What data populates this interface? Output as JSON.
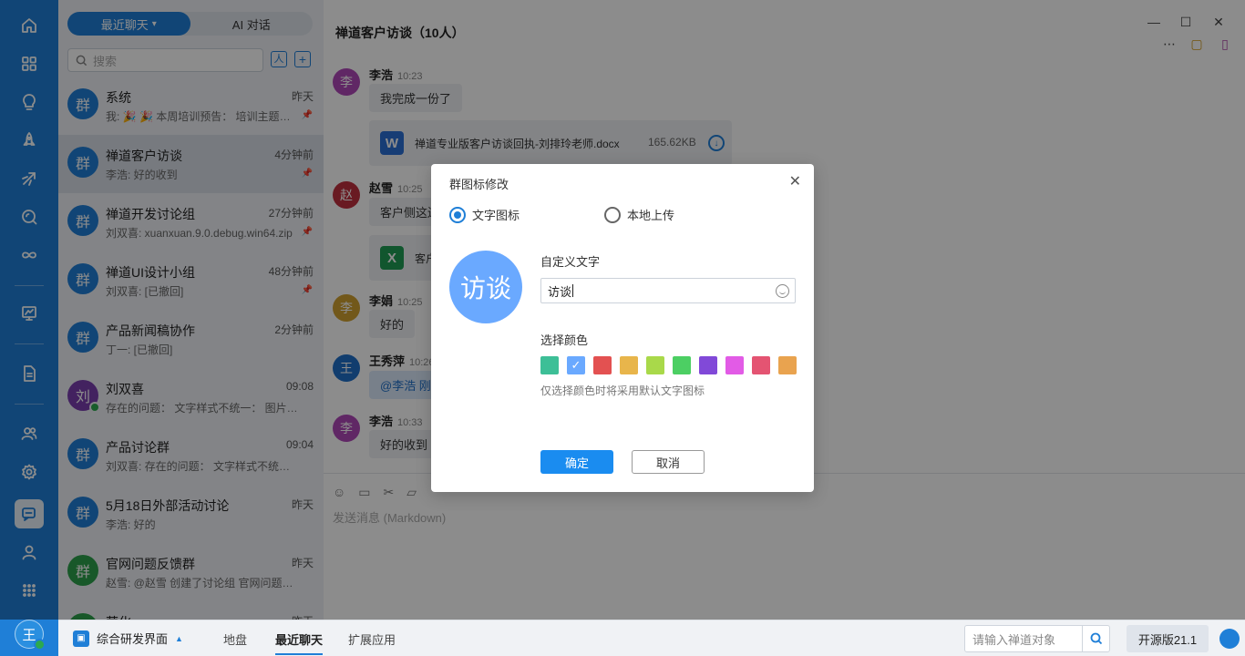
{
  "sidebar": {
    "icons": [
      "home-icon",
      "apps-icon",
      "lightbulb-icon",
      "rocket-icon",
      "sprint-icon",
      "search-icon",
      "infinity-icon",
      "screen-chart-icon",
      "document-icon",
      "team-icon",
      "settings-icon",
      "chat-icon",
      "user-icon",
      "grid-icon"
    ],
    "avatar_letter": "王"
  },
  "list": {
    "tabs": [
      "最近聊天",
      "AI 对话"
    ],
    "search_placeholder": "搜索",
    "conversations": [
      {
        "avatar": "群",
        "name": "系统",
        "time": "昨天",
        "preview": "我: 🎉 🎉 本周培训预告：  培训主题：...",
        "pinned": true
      },
      {
        "avatar": "群",
        "name": "禅道客户访谈",
        "time": "4分钟前",
        "preview": "李浩: 好的收到",
        "pinned": true
      },
      {
        "avatar": "群",
        "name": "禅道开发讨论组",
        "time": "27分钟前",
        "preview": "刘双喜: xuanxuan.9.0.debug.win64.zip",
        "pinned": true
      },
      {
        "avatar": "群",
        "name": "禅道UI设计小组",
        "time": "48分钟前",
        "preview": "刘双喜: [已撤回]",
        "pinned": true
      },
      {
        "avatar": "群",
        "name": "产品新闻稿协作",
        "time": "2分钟前",
        "preview": "丁一: [已撤回]",
        "pinned": false
      },
      {
        "avatar": "刘",
        "name": "刘双喜",
        "time": "09:08",
        "preview": "存在的问题：  文字样式不统一：  图片大...",
        "pinned": false
      },
      {
        "avatar": "群",
        "name": "产品讨论群",
        "time": "09:04",
        "preview": "刘双喜: 存在的问题：  文字样式不统一：...",
        "pinned": false
      },
      {
        "avatar": "群",
        "name": "5月18日外部活动讨论",
        "time": "昨天",
        "preview": "李浩: 好的",
        "pinned": false
      },
      {
        "avatar": "群",
        "name": "官网问题反馈群",
        "time": "昨天",
        "preview": "赵雪: @赵雪 创建了讨论组 官网问题反...",
        "pinned": false
      },
      {
        "avatar": "",
        "name": "营化",
        "time": "昨天",
        "preview": "",
        "pinned": false
      }
    ]
  },
  "chat": {
    "title": "禅道客户访谈（10人）",
    "messages": [
      {
        "avatar": "李",
        "name": "李浩",
        "time": "10:23",
        "text": "我完成一份了"
      },
      {
        "avatar": "赵",
        "name": "赵雪",
        "time": "10:25",
        "text": "客户侧这边"
      },
      {
        "avatar": "李",
        "name": "李娟",
        "time": "10:25",
        "text": "好的"
      },
      {
        "avatar": "王",
        "name": "王秀萍",
        "time": "10:26",
        "text": "@李浩 刚"
      },
      {
        "avatar": "李",
        "name": "李浩",
        "time": "10:33",
        "text": "好的收到"
      }
    ],
    "file": {
      "icon": "W",
      "name": "禅道专业版客户访谈回执-刘排玲老师.docx",
      "size": "165.62KB"
    },
    "file2_icon": "X",
    "file2_text": "客户",
    "composer_placeholder": "发送消息 (Markdown)"
  },
  "bottom": {
    "workspace": "综合研发界面",
    "tabs": [
      "地盘",
      "最近聊天",
      "扩展应用"
    ],
    "search_placeholder": "请输入禅道对象",
    "version": "开源版21.1"
  },
  "dialog": {
    "title": "群图标修改",
    "option_text": "文字图标",
    "option_upload": "本地上传",
    "preview_text": "访谈",
    "custom_label": "自定义文字",
    "input_value": "访谈",
    "color_label": "选择颜色",
    "colors": [
      "#3dbf97",
      "#6aa9ff",
      "#e35151",
      "#e8b54b",
      "#a9d94a",
      "#4ccf63",
      "#8149d8",
      "#e25be6",
      "#e45472",
      "#e9a34f"
    ],
    "selected_color_index": 1,
    "hint": "仅选择颜色时将采用默认文字图标",
    "confirm": "确定",
    "cancel": "取消"
  }
}
